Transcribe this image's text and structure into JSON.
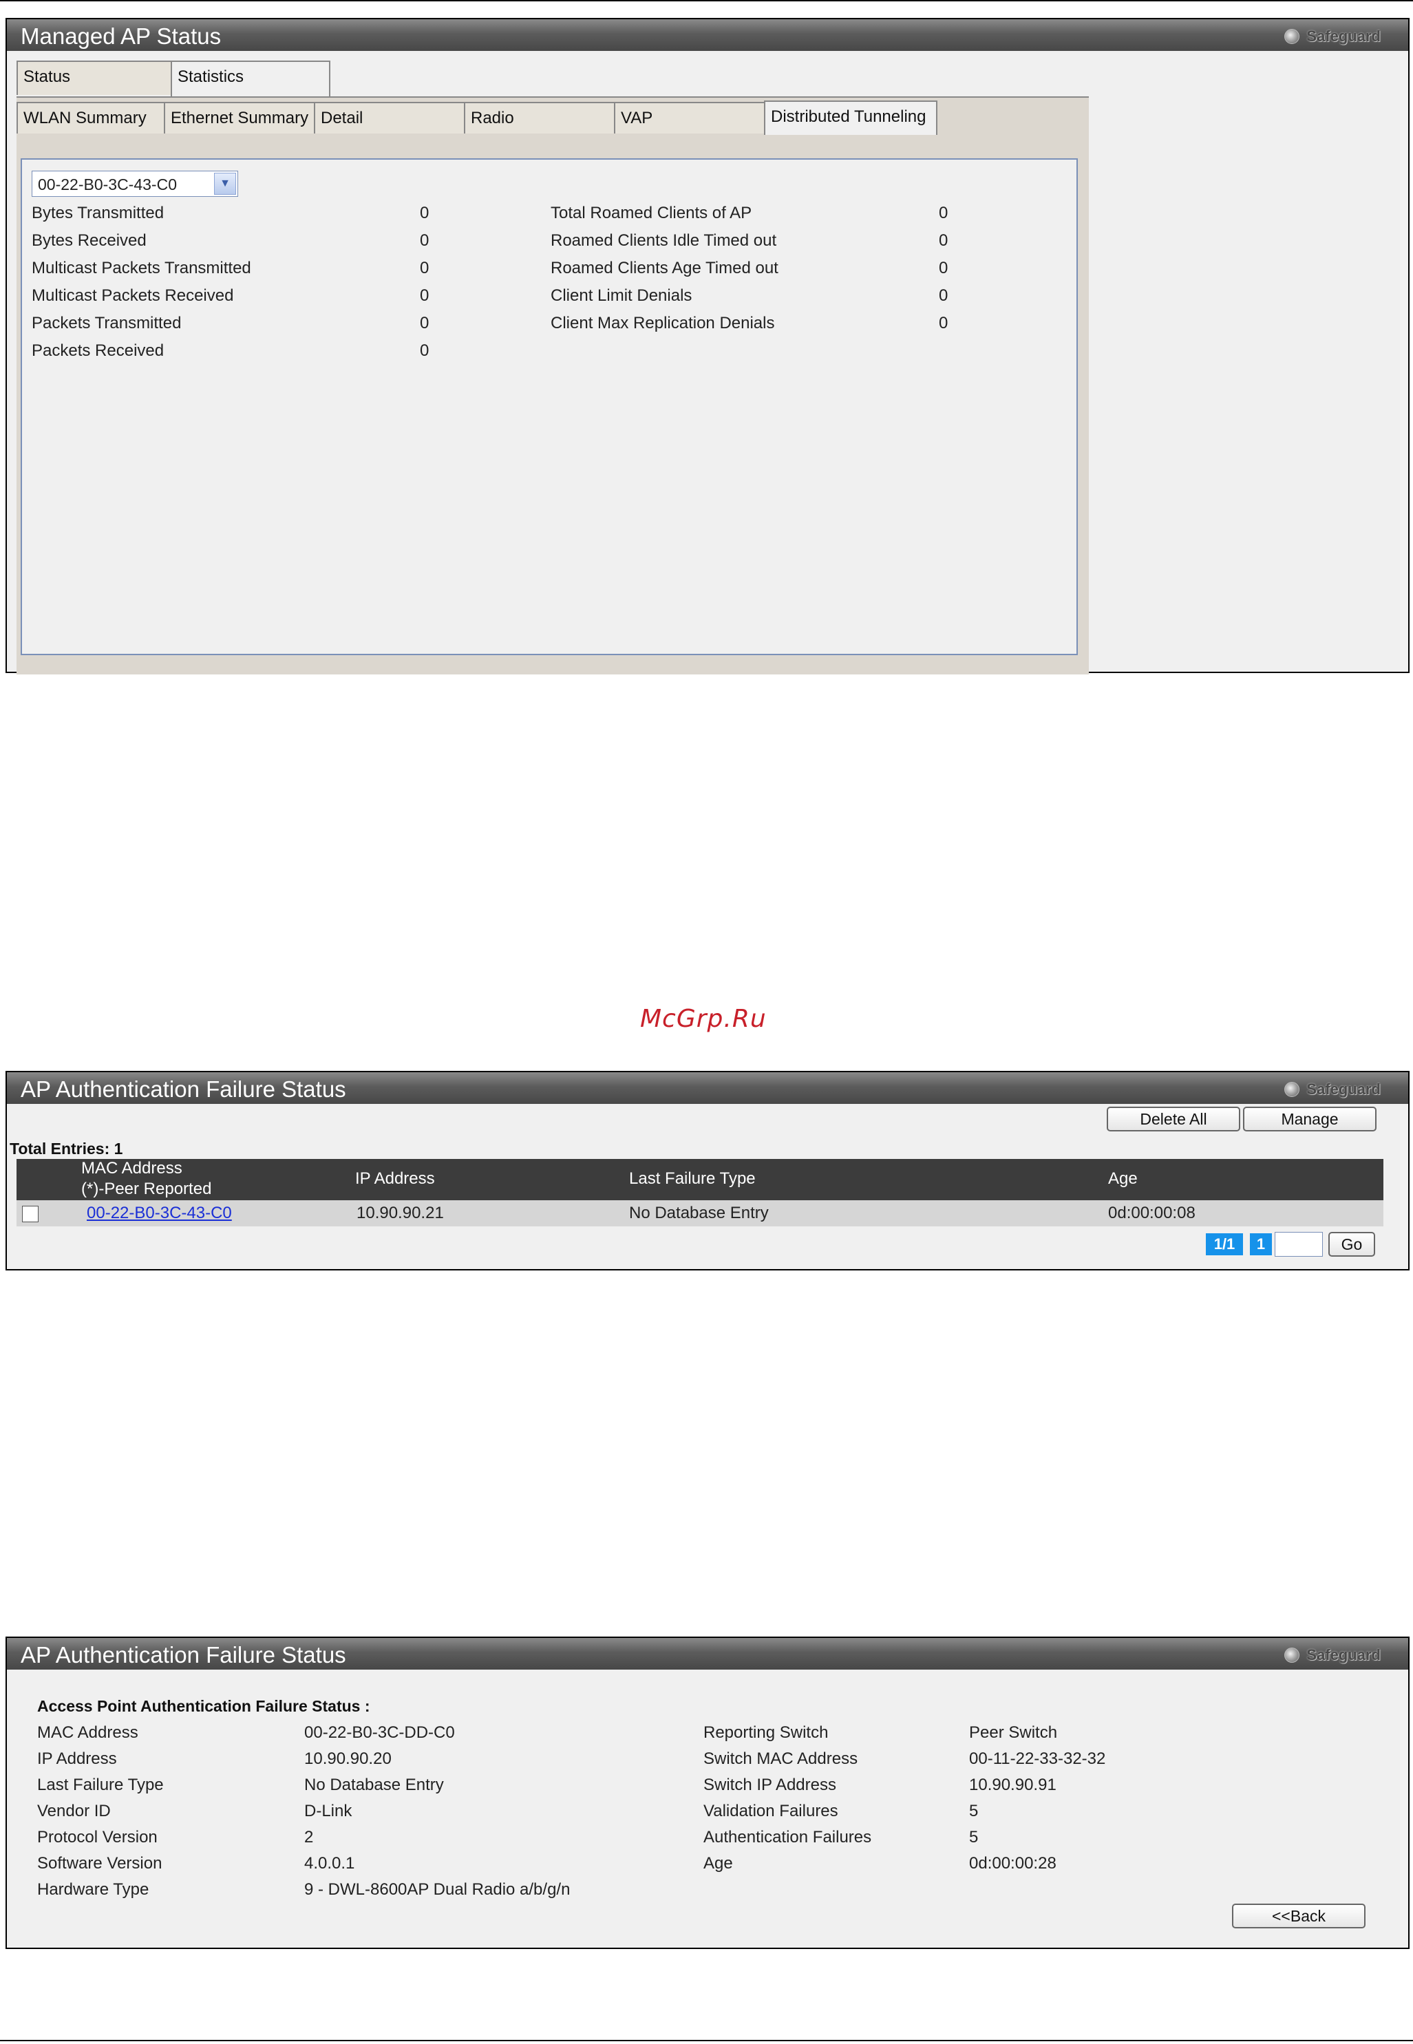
{
  "panel1": {
    "title": "Managed AP Status",
    "safeguard": "Safeguard",
    "top_tabs": [
      "Status",
      "Statistics"
    ],
    "sub_tabs": [
      "WLAN Summary",
      "Ethernet Summary",
      "Detail",
      "Radio",
      "VAP",
      "Distributed Tunneling"
    ],
    "dropdown_value": "00-22-B0-3C-43-C0",
    "left_stats": [
      {
        "label": "Bytes Transmitted",
        "value": "0"
      },
      {
        "label": "Bytes Received",
        "value": "0"
      },
      {
        "label": "Multicast Packets Transmitted",
        "value": "0"
      },
      {
        "label": "Multicast Packets Received",
        "value": "0"
      },
      {
        "label": "Packets Transmitted",
        "value": "0"
      },
      {
        "label": "Packets Received",
        "value": "0"
      }
    ],
    "right_stats": [
      {
        "label": "Total Roamed Clients of AP",
        "value": "0"
      },
      {
        "label": "Roamed Clients Idle Timed out",
        "value": "0"
      },
      {
        "label": "Roamed Clients Age Timed out",
        "value": "0"
      },
      {
        "label": "Client Limit Denials",
        "value": "0"
      },
      {
        "label": "Client Max Replication Denials",
        "value": "0"
      }
    ]
  },
  "watermark": "McGrp.Ru",
  "panel2": {
    "title": "AP Authentication Failure Status",
    "safeguard": "Safeguard",
    "delete_all": "Delete All",
    "manage": "Manage",
    "total_entries": "Total Entries: 1",
    "headers": {
      "mac_line1": "MAC Address",
      "mac_line2": "(*)-Peer Reported",
      "ip": "IP Address",
      "last_failure": "Last Failure Type",
      "age": "Age"
    },
    "row": {
      "mac": "00-22-B0-3C-43-C0",
      "ip": "10.90.90.21",
      "last_failure": "No Database Entry",
      "age": "0d:00:00:08"
    },
    "pager": {
      "pages": "1/1",
      "current": "1",
      "go": "Go"
    }
  },
  "panel3": {
    "title": "AP Authentication Failure Status",
    "safeguard": "Safeguard",
    "heading": "Access Point Authentication Failure Status :",
    "left": [
      {
        "label": "MAC Address",
        "value": "00-22-B0-3C-DD-C0"
      },
      {
        "label": "IP Address",
        "value": "10.90.90.20"
      },
      {
        "label": "Last Failure Type",
        "value": "No Database Entry"
      },
      {
        "label": "Vendor ID",
        "value": "D-Link"
      },
      {
        "label": "Protocol Version",
        "value": "2"
      },
      {
        "label": "Software Version",
        "value": "4.0.0.1"
      },
      {
        "label": "Hardware Type",
        "value": "9 - DWL-8600AP Dual Radio a/b/g/n"
      }
    ],
    "right": [
      {
        "label": "Reporting Switch",
        "value": "Peer Switch"
      },
      {
        "label": "Switch MAC Address",
        "value": "00-11-22-33-32-32"
      },
      {
        "label": "Switch IP Address",
        "value": "10.90.90.91"
      },
      {
        "label": "Validation Failures",
        "value": "5"
      },
      {
        "label": "Authentication Failures",
        "value": "5"
      },
      {
        "label": "Age",
        "value": "0d:00:00:28"
      }
    ],
    "back": "<<Back"
  }
}
